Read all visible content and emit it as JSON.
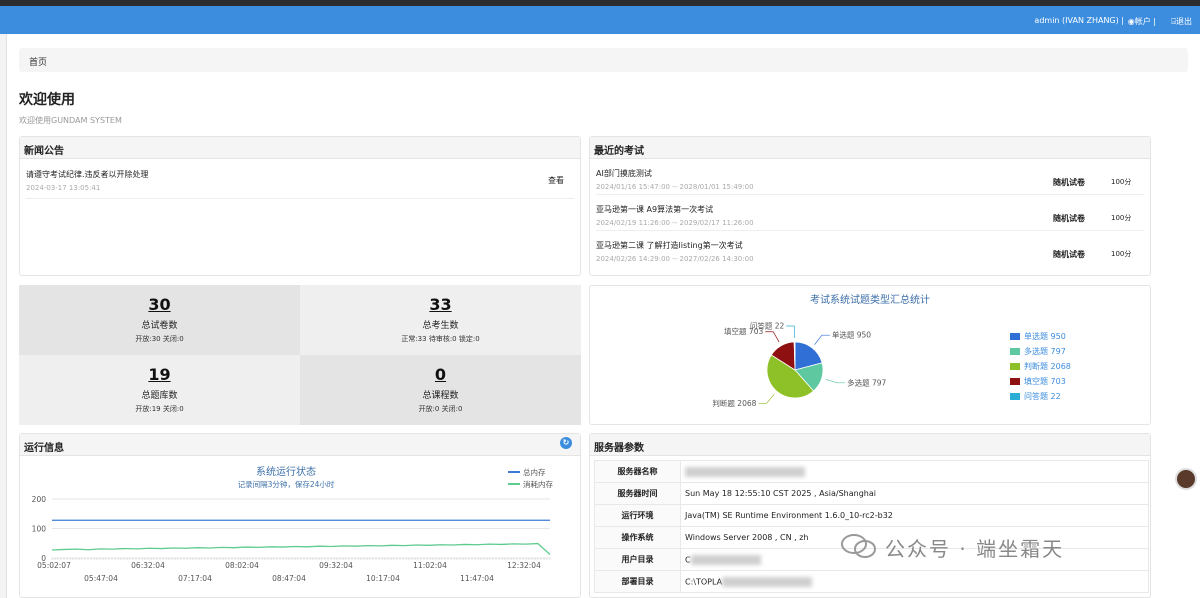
{
  "header": {
    "user": "admin (IVAN ZHANG)",
    "account_label": "帐户",
    "logout_label": "退出"
  },
  "breadcrumb": "首页",
  "page": {
    "title": "欢迎使用",
    "subtitle": "欢迎使用GUNDAM SYSTEM"
  },
  "news": {
    "title": "新闻公告",
    "items": [
      {
        "title": "请遵守考试纪律.违反者以开除处理",
        "date": "2024-03-17 13:05:41",
        "action": "查看"
      }
    ]
  },
  "exams": {
    "title": "最近的考试",
    "items": [
      {
        "name": "AI部门摸底测试",
        "time": "2024/01/16 15:47:00 -- 2028/01/01 15:49:00",
        "type": "随机试卷",
        "score": "100分"
      },
      {
        "name": "亚马逊第一课 A9算法第一次考试",
        "time": "2024/02/19 11:26:00 -- 2029/02/17 11:26:00",
        "type": "随机试卷",
        "score": "100分"
      },
      {
        "name": "亚马逊第二课 了解打造listing第一次考试",
        "time": "2024/02/26 14:29:00 -- 2027/02/26 14:30:00",
        "type": "随机试卷",
        "score": "100分"
      }
    ]
  },
  "stats": [
    {
      "num": "30",
      "label": "总试卷数",
      "sub": "开放:30 关闭:0"
    },
    {
      "num": "33",
      "label": "总考生数",
      "sub": "正常:33 待审核:0 锁定:0"
    },
    {
      "num": "19",
      "label": "总题库数",
      "sub": "开放:19 关闭:0"
    },
    {
      "num": "0",
      "label": "总课程数",
      "sub": "开放:0 关闭:0"
    }
  ],
  "chart_data": [
    {
      "type": "pie",
      "title": "考试系统试题类型汇总统计",
      "categories": [
        "单选题",
        "多选题",
        "判断题",
        "填空题",
        "问答题"
      ],
      "values": [
        950,
        797,
        2068,
        703,
        22
      ],
      "colors": [
        "#2f6fd6",
        "#5ec8a0",
        "#8ec127",
        "#8e1010",
        "#2aaed6"
      ],
      "legend": "right"
    },
    {
      "type": "line",
      "title": "系统运行状态",
      "subtitle": "记录间隔3分钟，保存24小时",
      "series": [
        {
          "name": "总内存",
          "color": "#3c7bd4",
          "values": [
            128,
            128,
            128,
            128,
            128,
            128,
            128,
            128,
            128,
            128,
            128,
            128,
            128,
            128,
            128,
            128,
            128,
            128,
            128,
            128,
            128,
            128,
            128,
            128,
            128,
            128,
            128,
            128,
            128,
            128,
            128,
            128,
            128,
            128,
            128,
            128,
            128,
            128,
            128,
            128,
            128,
            128
          ]
        },
        {
          "name": "消耗内存",
          "color": "#5ecb8f",
          "values": [
            27,
            29,
            30,
            28,
            31,
            30,
            32,
            31,
            33,
            32,
            34,
            33,
            35,
            34,
            36,
            35,
            37,
            36,
            38,
            37,
            39,
            38,
            40,
            39,
            41,
            40,
            42,
            41,
            43,
            42,
            44,
            43,
            45,
            44,
            46,
            45,
            47,
            46,
            48,
            47,
            49,
            12
          ]
        }
      ],
      "ylim": [
        0,
        200
      ],
      "yticks": [
        "200",
        "100",
        "0"
      ],
      "xticks_top": [
        "05:02:07",
        "06:32:04",
        "08:02:04",
        "09:32:04",
        "11:02:04",
        "12:32:04"
      ],
      "xticks_bottom": [
        "05:47:04",
        "07:17:04",
        "08:47:04",
        "10:17:04",
        "11:47:04"
      ],
      "legend": "top-right",
      "grid": true
    }
  ],
  "run_info": {
    "title": "运行信息"
  },
  "server": {
    "title": "服务器参数",
    "rows": [
      {
        "key": "服务器名称",
        "value": ""
      },
      {
        "key": "服务器时间",
        "value": "Sun May 18 12:55:10 CST 2025 , Asia/Shanghai"
      },
      {
        "key": "运行环境",
        "value": "Java(TM) SE Runtime Environment 1.6.0_10-rc2-b32"
      },
      {
        "key": "操作系统",
        "value": "Windows Server 2008 , CN , zh"
      },
      {
        "key": "用户目录",
        "value": "C"
      },
      {
        "key": "部署目录",
        "value": "C:\\TOPLA"
      }
    ]
  },
  "watermark": "公众号 · 端坐霜天"
}
